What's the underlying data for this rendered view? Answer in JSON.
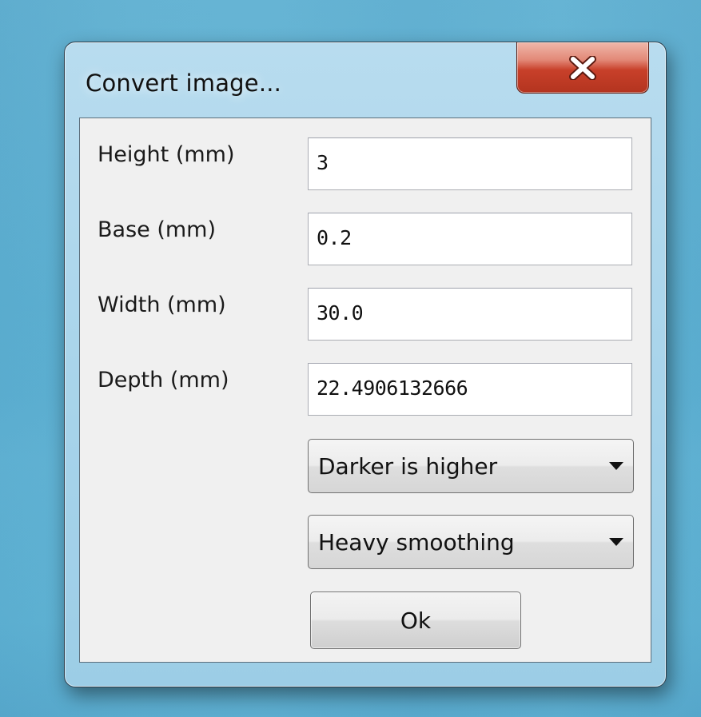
{
  "window": {
    "title": "Convert image...",
    "close_icon": "close-icon"
  },
  "form": {
    "height_label": "Height (mm)",
    "height_value": "3",
    "base_label": "Base (mm)",
    "base_value": "0.2",
    "width_label": "Width (mm)",
    "width_value": "30.0",
    "depth_label": "Depth (mm)",
    "depth_value": "22.4906132666",
    "mode_selected": "Darker is higher",
    "smoothing_selected": "Heavy smoothing",
    "ok_label": "Ok"
  },
  "colors": {
    "close_button": "#c8402a",
    "frame": "#a6d3ea",
    "client": "#f0f0f0"
  }
}
